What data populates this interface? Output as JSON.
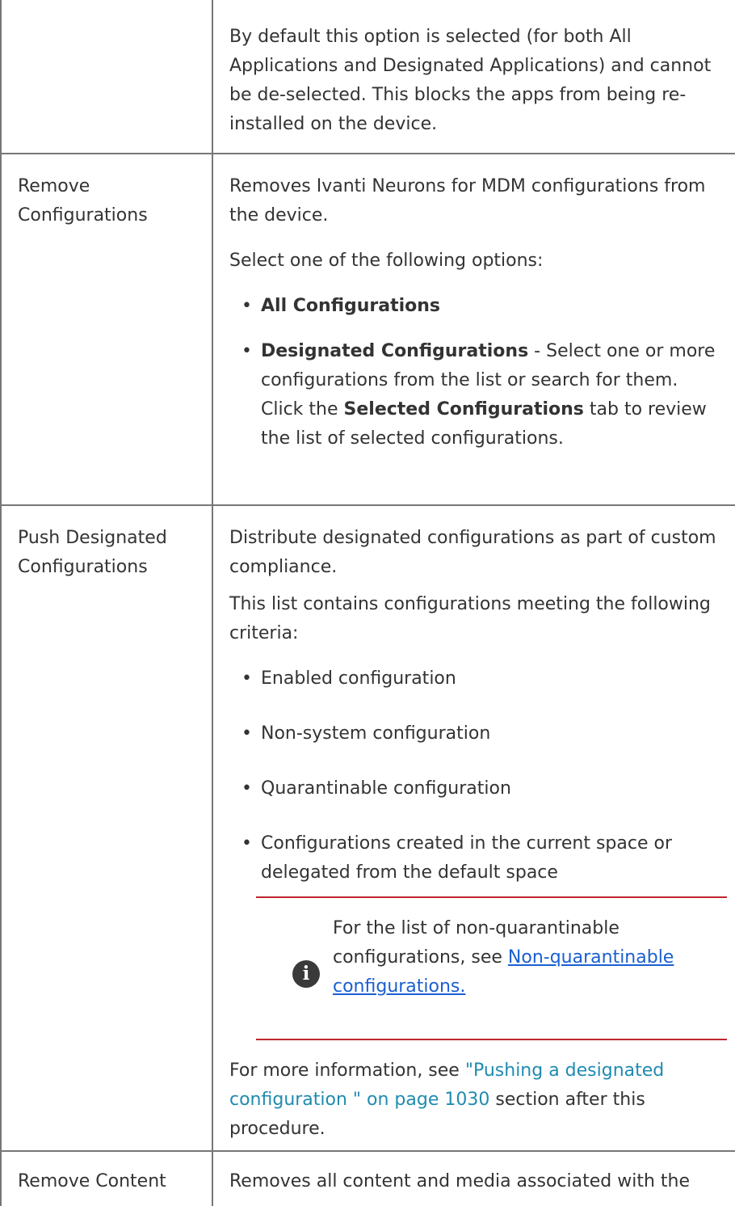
{
  "rows": [
    {
      "label": "",
      "paragraphs": [
        "By default this option is selected (for both All Applications and Designated Applications) and cannot be de-selected. This blocks the apps from being re-installed on the device."
      ]
    },
    {
      "label": "Remove Configurations",
      "intro": "Removes Ivanti Neurons for MDM configurations from the device.",
      "select": "Select one of the following options:",
      "bullets": [
        {
          "bold": "All Configurations"
        },
        {
          "bold": "Designated Configurations",
          "text_a": " - Select one or more configurations from the list or search for them. Click the ",
          "bold_b": "Selected Configurations",
          "text_b": " tab to review the list of selected configurations."
        }
      ]
    },
    {
      "label": "Push Designated Configurations",
      "intro": "Distribute designated configurations as part of custom compliance.",
      "criteria": "This list contains configurations meeting the following criteria:",
      "bullets": [
        "Enabled configuration",
        "Non-system configuration",
        "Quarantinable configuration",
        "Configurations created in the current space or delegated from the default space"
      ],
      "note": {
        "icon": "info-icon",
        "text": "For the list of non-quarantinable configurations, see ",
        "link": "Non-quarantinable configurations."
      },
      "more_prefix": "For more information, see ",
      "more_link": "\"Pushing a designated configuration \" on page 1030",
      "more_suffix": " section after this procedure."
    },
    {
      "label": "Remove Content",
      "intro": "Removes all content and media associated with the"
    }
  ],
  "colors": {
    "grid": "#777777",
    "note_rule": "#c0272d",
    "link": "#1a5fd1",
    "xref": "#1f8bb0"
  }
}
